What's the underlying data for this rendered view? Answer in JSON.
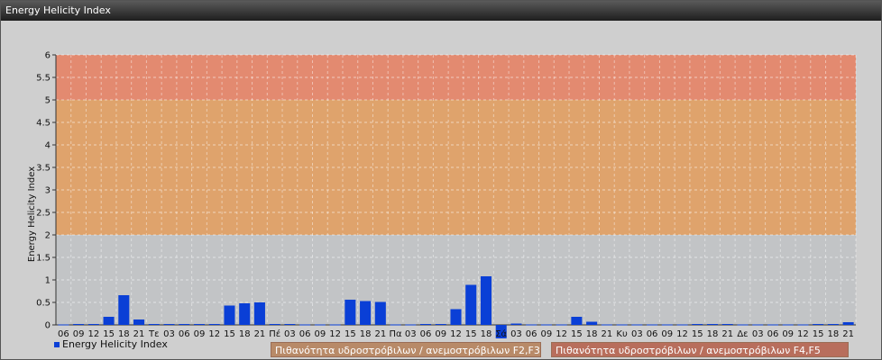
{
  "window": {
    "title": "Energy Helicity Index"
  },
  "legend": {
    "series_label": "Energy Helicity Index",
    "band_f2f3": "Πιθανότητα υδροστρόβιλων / ανεμοστρόβιλων F2,F3",
    "band_f4f5": "Πιθανότητα υδροστρόβιλων / ανεμοστρόβιλων F4,F5"
  },
  "colors": {
    "bar": "#0a3fd6",
    "band_low": "#c2c4c6",
    "band_mid": "#dfa36c",
    "band_high": "#e38a70"
  },
  "chart_data": {
    "type": "bar",
    "ylabel": "Energy Helicity Index",
    "ylim": [
      0,
      6
    ],
    "yticks": [
      "0",
      "0.5",
      "1",
      "1.5",
      "2",
      "2.5",
      "3",
      "3.5",
      "4",
      "4.5",
      "5",
      "5.5",
      "6"
    ],
    "bands": [
      {
        "from": 0,
        "to": 2,
        "color": "#c2c4c6"
      },
      {
        "from": 2,
        "to": 5,
        "color": "#dfa36c"
      },
      {
        "from": 5,
        "to": 6,
        "color": "#e38a70"
      }
    ],
    "categories": [
      "06",
      "09",
      "12",
      "15",
      "18",
      "21",
      "Τε",
      "03",
      "06",
      "09",
      "12",
      "15",
      "18",
      "21",
      "Πέ",
      "03",
      "06",
      "09",
      "12",
      "15",
      "18",
      "21",
      "Πα",
      "03",
      "06",
      "09",
      "12",
      "15",
      "18",
      "Σά",
      "03",
      "06",
      "09",
      "12",
      "15",
      "18",
      "21",
      "Κυ",
      "03",
      "06",
      "09",
      "12",
      "15",
      "18",
      "21",
      "Δε",
      "03",
      "06",
      "09",
      "12",
      "15",
      "18",
      "21"
    ],
    "series": [
      {
        "name": "Energy Helicity Index",
        "values": [
          0.01,
          0.02,
          0.02,
          0.18,
          0.66,
          0.12,
          0.02,
          0.02,
          0.02,
          0.02,
          0.02,
          0.43,
          0.48,
          0.5,
          0.02,
          0.02,
          0.01,
          0.01,
          0.01,
          0.56,
          0.53,
          0.51,
          0.01,
          0.01,
          0.02,
          0.02,
          0.35,
          0.89,
          1.08,
          -0.3,
          0.03,
          0.01,
          0.01,
          0.01,
          0.18,
          0.07,
          0.01,
          0.01,
          0.01,
          0.01,
          0.01,
          0.01,
          0.02,
          0.02,
          0.02,
          0.01,
          0.01,
          0.01,
          0.01,
          0.01,
          0.02,
          0.02,
          0.06
        ]
      }
    ]
  }
}
